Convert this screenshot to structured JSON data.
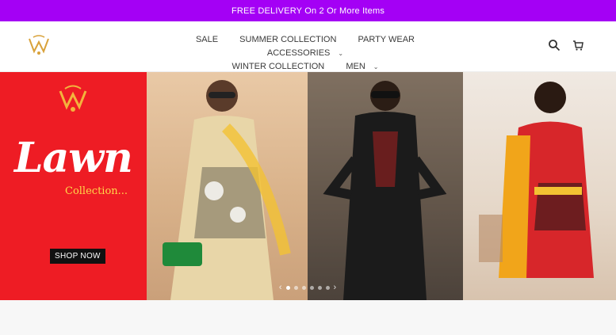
{
  "announcement": "FREE DELIVERY On 2 Or More Items",
  "nav": {
    "row1": [
      {
        "label": "SALE",
        "dropdown": false
      },
      {
        "label": "SUMMER COLLECTION",
        "dropdown": false
      },
      {
        "label": "PARTY WEAR",
        "dropdown": false
      },
      {
        "label": "ACCESSORIES",
        "dropdown": true
      }
    ],
    "row2": [
      {
        "label": "WINTER COLLECTION",
        "dropdown": false
      },
      {
        "label": "MEN",
        "dropdown": true
      }
    ]
  },
  "header_icons": [
    "search-icon",
    "cart-icon"
  ],
  "hero": {
    "headline": "Lawn",
    "subheadline": "Collection...",
    "cta": "SHOP NOW",
    "slides_count": 6,
    "active_slide": 1
  },
  "colors": {
    "announcement_bg": "#a400f5",
    "hero_red": "#ee1c24",
    "accent_gold": "#ffd84a"
  }
}
